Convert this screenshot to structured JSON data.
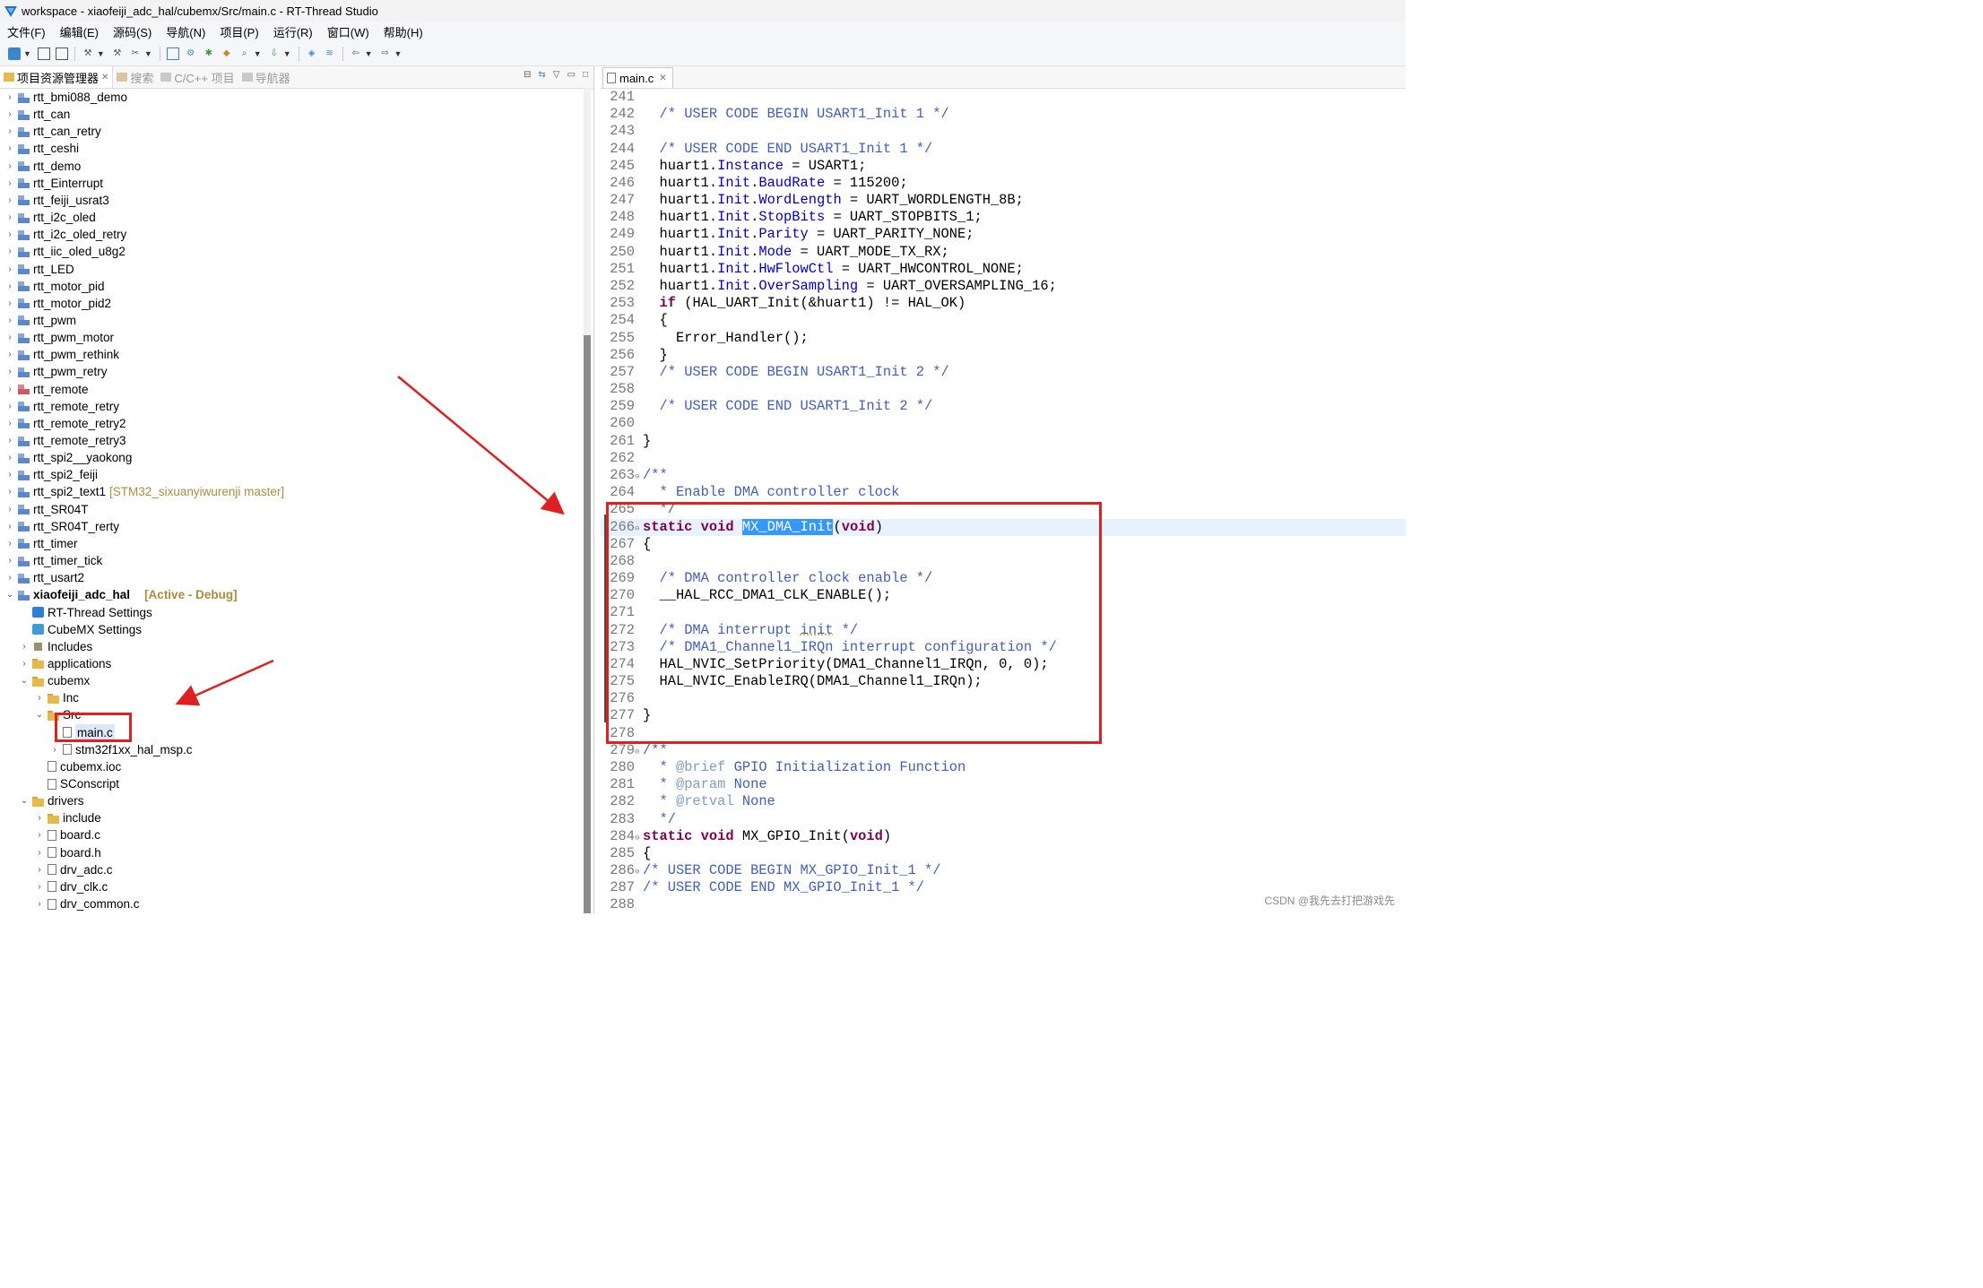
{
  "window": {
    "title": "workspace - xiaofeiji_adc_hal/cubemx/Src/main.c - RT-Thread Studio"
  },
  "menu": [
    "文件(F)",
    "编辑(E)",
    "源码(S)",
    "导航(N)",
    "项目(P)",
    "运行(R)",
    "窗口(W)",
    "帮助(H)"
  ],
  "left_panel": {
    "tabs": [
      {
        "label": "项目资源管理器",
        "active": true
      },
      {
        "label": "搜索",
        "active": false
      },
      {
        "label": "C/C++ 项目",
        "active": false
      },
      {
        "label": "导航器",
        "active": false
      }
    ],
    "tree": [
      {
        "depth": 0,
        "arrow": "›",
        "icon": "proj",
        "label": "rtt_bmi088_demo"
      },
      {
        "depth": 0,
        "arrow": "›",
        "icon": "proj",
        "label": "rtt_can"
      },
      {
        "depth": 0,
        "arrow": "›",
        "icon": "proj",
        "label": "rtt_can_retry"
      },
      {
        "depth": 0,
        "arrow": "›",
        "icon": "proj",
        "label": "rtt_ceshi"
      },
      {
        "depth": 0,
        "arrow": "›",
        "icon": "proj",
        "label": "rtt_demo"
      },
      {
        "depth": 0,
        "arrow": "›",
        "icon": "proj",
        "label": "rtt_Einterrupt"
      },
      {
        "depth": 0,
        "arrow": "›",
        "icon": "proj",
        "label": "rtt_feiji_usrat3"
      },
      {
        "depth": 0,
        "arrow": "›",
        "icon": "proj",
        "label": "rtt_i2c_oled"
      },
      {
        "depth": 0,
        "arrow": "›",
        "icon": "proj",
        "label": "rtt_i2c_oled_retry"
      },
      {
        "depth": 0,
        "arrow": "›",
        "icon": "proj",
        "label": "rtt_iic_oled_u8g2"
      },
      {
        "depth": 0,
        "arrow": "›",
        "icon": "proj",
        "label": "rtt_LED"
      },
      {
        "depth": 0,
        "arrow": "›",
        "icon": "proj",
        "label": "rtt_motor_pid"
      },
      {
        "depth": 0,
        "arrow": "›",
        "icon": "proj",
        "label": "rtt_motor_pid2"
      },
      {
        "depth": 0,
        "arrow": "›",
        "icon": "proj",
        "label": "rtt_pwm"
      },
      {
        "depth": 0,
        "arrow": "›",
        "icon": "proj",
        "label": "rtt_pwm_motor"
      },
      {
        "depth": 0,
        "arrow": "›",
        "icon": "proj",
        "label": "rtt_pwm_rethink"
      },
      {
        "depth": 0,
        "arrow": "›",
        "icon": "proj",
        "label": "rtt_pwm_retry"
      },
      {
        "depth": 0,
        "arrow": "›",
        "icon": "projred",
        "label": "rtt_remote"
      },
      {
        "depth": 0,
        "arrow": "›",
        "icon": "proj",
        "label": "rtt_remote_retry"
      },
      {
        "depth": 0,
        "arrow": "›",
        "icon": "proj",
        "label": "rtt_remote_retry2"
      },
      {
        "depth": 0,
        "arrow": "›",
        "icon": "proj",
        "label": "rtt_remote_retry3"
      },
      {
        "depth": 0,
        "arrow": "›",
        "icon": "proj",
        "label": "rtt_spi2__yaokong"
      },
      {
        "depth": 0,
        "arrow": "›",
        "icon": "proj",
        "label": "rtt_spi2_feiji"
      },
      {
        "depth": 0,
        "arrow": "›",
        "icon": "proj",
        "label": "rtt_spi2_text1",
        "deco": "[STM32_sixuanyiwurenji master]"
      },
      {
        "depth": 0,
        "arrow": "›",
        "icon": "proj",
        "label": "rtt_SR04T"
      },
      {
        "depth": 0,
        "arrow": "›",
        "icon": "proj",
        "label": "rtt_SR04T_rerty"
      },
      {
        "depth": 0,
        "arrow": "›",
        "icon": "proj",
        "label": "rtt_timer"
      },
      {
        "depth": 0,
        "arrow": "›",
        "icon": "proj",
        "label": "rtt_timer_tick"
      },
      {
        "depth": 0,
        "arrow": "›",
        "icon": "proj",
        "label": "rtt_usart2"
      },
      {
        "depth": 0,
        "arrow": "⌄",
        "icon": "proj",
        "label": "xiaofeiji_adc_hal",
        "bold": true,
        "active": "[Active - Debug]"
      },
      {
        "depth": 1,
        "arrow": "",
        "icon": "rt",
        "label": "RT-Thread Settings"
      },
      {
        "depth": 1,
        "arrow": "",
        "icon": "cube",
        "label": "CubeMX Settings"
      },
      {
        "depth": 1,
        "arrow": "›",
        "icon": "inc",
        "label": "Includes"
      },
      {
        "depth": 1,
        "arrow": "›",
        "icon": "folder",
        "label": "applications"
      },
      {
        "depth": 1,
        "arrow": "⌄",
        "icon": "folder",
        "label": "cubemx"
      },
      {
        "depth": 2,
        "arrow": "›",
        "icon": "folder",
        "label": "Inc"
      },
      {
        "depth": 2,
        "arrow": "⌄",
        "icon": "folder",
        "label": "Src"
      },
      {
        "depth": 3,
        "arrow": "",
        "icon": "file",
        "label": "main.c",
        "selected": true
      },
      {
        "depth": 3,
        "arrow": "›",
        "icon": "file",
        "label": "stm32f1xx_hal_msp.c"
      },
      {
        "depth": 2,
        "arrow": "",
        "icon": "file",
        "label": "cubemx.ioc"
      },
      {
        "depth": 2,
        "arrow": "",
        "icon": "file",
        "label": "SConscript"
      },
      {
        "depth": 1,
        "arrow": "⌄",
        "icon": "folder",
        "label": "drivers"
      },
      {
        "depth": 2,
        "arrow": "›",
        "icon": "folder",
        "label": "include"
      },
      {
        "depth": 2,
        "arrow": "›",
        "icon": "file",
        "label": "board.c"
      },
      {
        "depth": 2,
        "arrow": "›",
        "icon": "file",
        "label": "board.h"
      },
      {
        "depth": 2,
        "arrow": "›",
        "icon": "file",
        "label": "drv_adc.c"
      },
      {
        "depth": 2,
        "arrow": "›",
        "icon": "file",
        "label": "drv_clk.c"
      },
      {
        "depth": 2,
        "arrow": "›",
        "icon": "file",
        "label": "drv_common.c"
      }
    ]
  },
  "editor": {
    "tab": "main.c",
    "lines": [
      {
        "n": "241",
        "fold": "",
        "t": []
      },
      {
        "n": "242",
        "fold": "",
        "t": [
          [
            "  ",
            ""
          ],
          [
            "/* USER CODE BEGIN USART1_Init 1 */",
            "cm"
          ]
        ]
      },
      {
        "n": "243",
        "fold": "",
        "t": []
      },
      {
        "n": "244",
        "fold": "",
        "t": [
          [
            "  ",
            ""
          ],
          [
            "/* USER CODE END USART1_Init 1 */",
            "cm"
          ]
        ]
      },
      {
        "n": "245",
        "fold": "",
        "t": [
          [
            "  huart1.",
            ""
          ],
          [
            "Instance",
            "field"
          ],
          [
            " = USART1;",
            ""
          ]
        ]
      },
      {
        "n": "246",
        "fold": "",
        "t": [
          [
            "  huart1.",
            ""
          ],
          [
            "Init",
            "field"
          ],
          [
            ".",
            ""
          ],
          [
            "BaudRate",
            "field"
          ],
          [
            " = 115200;",
            ""
          ]
        ]
      },
      {
        "n": "247",
        "fold": "",
        "t": [
          [
            "  huart1.",
            ""
          ],
          [
            "Init",
            "field"
          ],
          [
            ".",
            ""
          ],
          [
            "WordLength",
            "field"
          ],
          [
            " = UART_WORDLENGTH_8B;",
            ""
          ]
        ]
      },
      {
        "n": "248",
        "fold": "",
        "t": [
          [
            "  huart1.",
            ""
          ],
          [
            "Init",
            "field"
          ],
          [
            ".",
            ""
          ],
          [
            "StopBits",
            "field"
          ],
          [
            " = UART_STOPBITS_1;",
            ""
          ]
        ]
      },
      {
        "n": "249",
        "fold": "",
        "t": [
          [
            "  huart1.",
            ""
          ],
          [
            "Init",
            "field"
          ],
          [
            ".",
            ""
          ],
          [
            "Parity",
            "field"
          ],
          [
            " = UART_PARITY_NONE;",
            ""
          ]
        ]
      },
      {
        "n": "250",
        "fold": "",
        "t": [
          [
            "  huart1.",
            ""
          ],
          [
            "Init",
            "field"
          ],
          [
            ".",
            ""
          ],
          [
            "Mode",
            "field"
          ],
          [
            " = UART_MODE_TX_RX;",
            ""
          ]
        ]
      },
      {
        "n": "251",
        "fold": "",
        "t": [
          [
            "  huart1.",
            ""
          ],
          [
            "Init",
            "field"
          ],
          [
            ".",
            ""
          ],
          [
            "HwFlowCtl",
            "field"
          ],
          [
            " = UART_HWCONTROL_NONE;",
            ""
          ]
        ]
      },
      {
        "n": "252",
        "fold": "",
        "t": [
          [
            "  huart1.",
            ""
          ],
          [
            "Init",
            "field"
          ],
          [
            ".",
            ""
          ],
          [
            "OverSampling",
            "field"
          ],
          [
            " = UART_OVERSAMPLING_16;",
            ""
          ]
        ]
      },
      {
        "n": "253",
        "fold": "",
        "t": [
          [
            "  ",
            ""
          ],
          [
            "if",
            "kw"
          ],
          [
            " (HAL_UART_Init(&huart1) != HAL_OK)",
            ""
          ]
        ]
      },
      {
        "n": "254",
        "fold": "",
        "t": [
          [
            "  {",
            ""
          ]
        ]
      },
      {
        "n": "255",
        "fold": "",
        "t": [
          [
            "    Error_Handler();",
            ""
          ]
        ]
      },
      {
        "n": "256",
        "fold": "",
        "t": [
          [
            "  }",
            ""
          ]
        ]
      },
      {
        "n": "257",
        "fold": "",
        "t": [
          [
            "  ",
            ""
          ],
          [
            "/* USER CODE BEGIN USART1_Init 2 */",
            "cm"
          ]
        ]
      },
      {
        "n": "258",
        "fold": "",
        "t": []
      },
      {
        "n": "259",
        "fold": "",
        "t": [
          [
            "  ",
            ""
          ],
          [
            "/* USER CODE END USART1_Init 2 */",
            "cm"
          ]
        ]
      },
      {
        "n": "260",
        "fold": "",
        "t": []
      },
      {
        "n": "261",
        "fold": "",
        "t": [
          [
            "}",
            ""
          ]
        ]
      },
      {
        "n": "262",
        "fold": "",
        "t": []
      },
      {
        "n": "263",
        "fold": "⊖",
        "t": [
          [
            "/**",
            "doc"
          ]
        ]
      },
      {
        "n": "264",
        "fold": "",
        "t": [
          [
            "  * Enable DMA controller clock",
            "doc"
          ]
        ]
      },
      {
        "n": "265",
        "fold": "",
        "t": [
          [
            "  */",
            "doc"
          ]
        ]
      },
      {
        "n": "266",
        "fold": "⊖",
        "hl": true,
        "t": [
          [
            "static",
            "kw"
          ],
          [
            " ",
            ""
          ],
          [
            "void",
            "kw"
          ],
          [
            " ",
            ""
          ],
          [
            "MX_DMA_Init",
            "sel"
          ],
          [
            "(",
            ""
          ],
          [
            "void",
            "kw"
          ],
          [
            ")",
            ""
          ]
        ]
      },
      {
        "n": "267",
        "fold": "",
        "t": [
          [
            "{",
            ""
          ]
        ]
      },
      {
        "n": "268",
        "fold": "",
        "t": []
      },
      {
        "n": "269",
        "fold": "",
        "t": [
          [
            "  ",
            ""
          ],
          [
            "/* DMA controller clock enable */",
            "cm"
          ]
        ]
      },
      {
        "n": "270",
        "fold": "",
        "t": [
          [
            "  __HAL_RCC_DMA1_CLK_ENABLE();",
            ""
          ]
        ]
      },
      {
        "n": "271",
        "fold": "",
        "t": []
      },
      {
        "n": "272",
        "fold": "",
        "t": [
          [
            "  ",
            ""
          ],
          [
            "/* DMA interrupt ",
            "cm"
          ],
          [
            "init",
            "cmul"
          ],
          [
            " */",
            "cm"
          ]
        ]
      },
      {
        "n": "273",
        "fold": "",
        "t": [
          [
            "  ",
            ""
          ],
          [
            "/* DMA1_Channel1_IRQn interrupt configuration */",
            "cm"
          ]
        ]
      },
      {
        "n": "274",
        "fold": "",
        "t": [
          [
            "  HAL_NVIC_SetPriority(DMA1_Channel1_IRQn, 0, 0);",
            ""
          ]
        ]
      },
      {
        "n": "275",
        "fold": "",
        "t": [
          [
            "  HAL_NVIC_EnableIRQ(DMA1_Channel1_IRQn);",
            ""
          ]
        ]
      },
      {
        "n": "276",
        "fold": "",
        "t": []
      },
      {
        "n": "277",
        "fold": "",
        "t": [
          [
            "}",
            ""
          ]
        ]
      },
      {
        "n": "278",
        "fold": "",
        "t": []
      },
      {
        "n": "279",
        "fold": "⊖",
        "t": [
          [
            "/**",
            "doc"
          ]
        ]
      },
      {
        "n": "280",
        "fold": "",
        "t": [
          [
            "  * ",
            "doc"
          ],
          [
            "@brief",
            "tag"
          ],
          [
            " GPIO Initialization Function",
            "doc"
          ]
        ]
      },
      {
        "n": "281",
        "fold": "",
        "t": [
          [
            "  * ",
            "doc"
          ],
          [
            "@param",
            "tag"
          ],
          [
            " None",
            "doc"
          ]
        ]
      },
      {
        "n": "282",
        "fold": "",
        "t": [
          [
            "  * ",
            "doc"
          ],
          [
            "@retval",
            "tag"
          ],
          [
            " None",
            "doc"
          ]
        ]
      },
      {
        "n": "283",
        "fold": "",
        "t": [
          [
            "  */",
            "doc"
          ]
        ]
      },
      {
        "n": "284",
        "fold": "⊖",
        "t": [
          [
            "static",
            "kw"
          ],
          [
            " ",
            ""
          ],
          [
            "void",
            "kw"
          ],
          [
            " MX_GPIO_Init(",
            ""
          ],
          [
            "void",
            "kw"
          ],
          [
            ")",
            ""
          ]
        ]
      },
      {
        "n": "285",
        "fold": "",
        "t": [
          [
            "{",
            ""
          ]
        ]
      },
      {
        "n": "286",
        "fold": "⊖",
        "t": [
          [
            "/* USER CODE BEGIN MX_GPIO_Init_1 */",
            "cm"
          ]
        ]
      },
      {
        "n": "287",
        "fold": "",
        "t": [
          [
            "/* USER CODE END MX_GPIO_Init_1 */",
            "cm"
          ]
        ]
      },
      {
        "n": "288",
        "fold": "",
        "t": []
      }
    ]
  },
  "watermark": "CSDN @我先去打把游戏先"
}
